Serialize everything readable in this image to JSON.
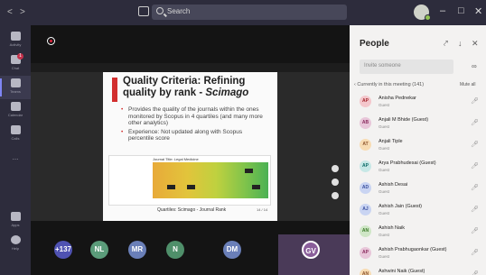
{
  "topbar": {
    "back": "<",
    "forward": ">",
    "search_placeholder": "Search",
    "avatar": "user-avatar",
    "minimize": "–",
    "maximize": "□",
    "close": "✕"
  },
  "rail": [
    {
      "label": "Activity",
      "icon": "bell-icon"
    },
    {
      "label": "Chat",
      "icon": "chat-icon",
      "badge": "1"
    },
    {
      "label": "Teams",
      "icon": "teams-icon",
      "active": true
    },
    {
      "label": "Calendar",
      "icon": "calendar-icon"
    },
    {
      "label": "Calls",
      "icon": "phone-icon"
    },
    {
      "label": "...",
      "icon": "more-icon"
    },
    {
      "label": "Apps",
      "icon": "apps-icon"
    },
    {
      "label": "Help",
      "icon": "help-icon"
    }
  ],
  "slide": {
    "title_line1": "Quality Criteria: Refining",
    "title_line2": "quality by rank - ",
    "title_italic": "Scimago",
    "bullet1": "Provides the quality of the journals within the ones monitored by Scopus in 4 quartiles (and many more other analytics)",
    "bullet2": "Experience: Not updated along with Scopus percentile score",
    "panel_title": "Journal Title: Legal Medicine",
    "footer": "Quartiles: Scimago - Journal Rank",
    "page": "14 / 14"
  },
  "participants_strip": [
    {
      "label": "+137",
      "color": "#4f52b2"
    },
    {
      "label": "NL",
      "color": "#5b9c7a"
    },
    {
      "label": "MR",
      "color": "#6a7fb8"
    },
    {
      "label": "N",
      "color": "#4f8f6a"
    },
    {
      "label": "DM",
      "color": "#6a7fb8"
    },
    {
      "label": "GV",
      "color": "#8a5e9a"
    }
  ],
  "people": {
    "title": "People",
    "invite_placeholder": "Invite someone",
    "section": "Currently in this meeting (141)",
    "mute_all": "Mute all",
    "list": [
      {
        "initials": "AP",
        "name": "Anisha Pednekar",
        "role": "Guest",
        "bg": "#f4c7cc",
        "fg": "#a4262c"
      },
      {
        "initials": "AB",
        "name": "Anjali M Bhide (Guest)",
        "role": "Guest",
        "bg": "#e8c6d9",
        "fg": "#8a2c5e"
      },
      {
        "initials": "AT",
        "name": "Anjali Tiple",
        "role": "Guest",
        "bg": "#f8dcb3",
        "fg": "#8e562e"
      },
      {
        "initials": "AP",
        "name": "Arya Prabhudesai (Guest)",
        "role": "Guest",
        "bg": "#c7e8e6",
        "fg": "#0b6a66"
      },
      {
        "initials": "AD",
        "name": "Ashish Desai",
        "role": "Guest",
        "bg": "#c9d4f2",
        "fg": "#3a4f9e"
      },
      {
        "initials": "AJ",
        "name": "Ashish Jain (Guest)",
        "role": "Guest",
        "bg": "#c9d4f2",
        "fg": "#3a4f9e"
      },
      {
        "initials": "AN",
        "name": "Ashish Naik",
        "role": "Guest",
        "bg": "#cfe6c6",
        "fg": "#3b7a28"
      },
      {
        "initials": "AP",
        "name": "Ashish Prabhugaonkar (Guest)",
        "role": "Guest",
        "bg": "#e8c6d9",
        "fg": "#8a2c5e"
      },
      {
        "initials": "AN",
        "name": "Ashwini Naik (Guest)",
        "role": "Guest",
        "bg": "#f8dcb3",
        "fg": "#8e562e"
      }
    ]
  }
}
